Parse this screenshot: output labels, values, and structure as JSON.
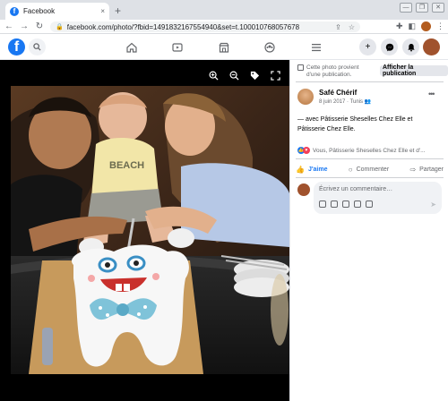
{
  "browser": {
    "tab_title": "Facebook",
    "tab_favicon": "f",
    "tab_close": "×",
    "new_tab": "+",
    "url": "facebook.com/photo/?fbid=1491832167554940&set=t.100010768057678",
    "window_controls": [
      "—",
      "❐",
      "✕"
    ]
  },
  "fb": {
    "logo": "f",
    "nav_icons": [
      "home-icon",
      "watch-icon",
      "marketplace-icon",
      "groups-icon",
      "menu-icon"
    ],
    "right_icons": [
      "plus-icon",
      "messenger-icon",
      "notifications-icon",
      "account-avatar"
    ]
  },
  "photo_viewer": {
    "tools": [
      "zoom-in-icon",
      "zoom-out-icon",
      "tag-icon",
      "fullscreen-icon"
    ]
  },
  "post": {
    "notice": "Cette photo provient d'une publication.",
    "notice_button": "Afficher la publication",
    "author": "Safé Chérif",
    "date": "8 juin 2017",
    "location": "Tunis",
    "caption": "— avec Pâtisserie Sheselles Chez Elle et Pâtisserie Chez Elle.",
    "reactions_text": "Vous, Pâtisserie Sheselles Chez Elle et d'...",
    "actions": {
      "like": "J'aime",
      "comment": "Commenter",
      "share": "Partager"
    },
    "comment_placeholder": "Écrivez un commentaire…"
  },
  "colors": {
    "fb_blue": "#1877f2",
    "love_red": "#f33e58",
    "text_secondary": "#65676b"
  }
}
